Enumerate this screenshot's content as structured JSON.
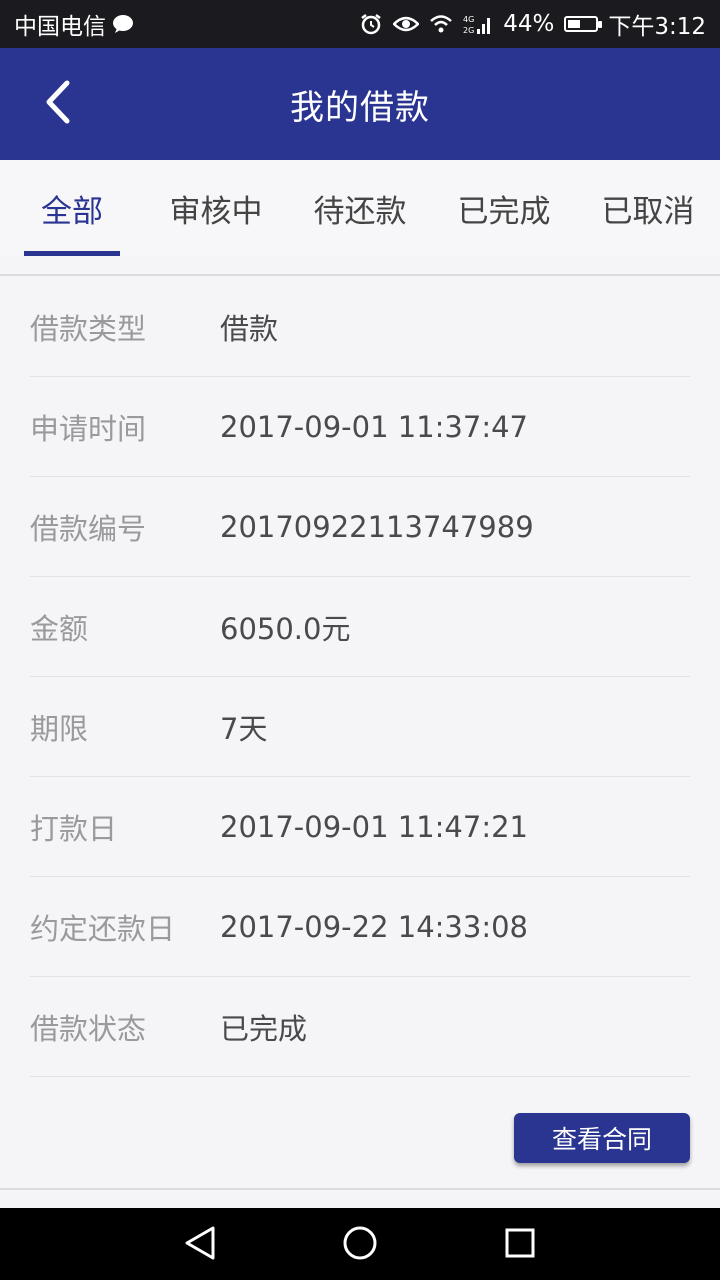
{
  "status_bar": {
    "carrier": "中国电信",
    "battery": "44%",
    "time": "下午3:12",
    "battery_level": 0.44,
    "icons": [
      "chat-bubble-icon",
      "alarm-icon",
      "eye-icon",
      "wifi-icon",
      "signal-icon",
      "battery-icon"
    ]
  },
  "header": {
    "title": "我的借款",
    "back_icon": "chevron-left-icon",
    "color": "#2a3491"
  },
  "tabs": [
    {
      "label": "全部",
      "active": true
    },
    {
      "label": "审核中",
      "active": false
    },
    {
      "label": "待还款",
      "active": false
    },
    {
      "label": "已完成",
      "active": false
    },
    {
      "label": "已取消",
      "active": false
    }
  ],
  "details": [
    {
      "label": "借款类型",
      "value": "借款"
    },
    {
      "label": "申请时间",
      "value": "2017-09-01 11:37:47"
    },
    {
      "label": "借款编号",
      "value": "20170922113747989"
    },
    {
      "label": "金额",
      "value": "6050.0元"
    },
    {
      "label": "期限",
      "value": "7天"
    },
    {
      "label": "打款日",
      "value": "2017-09-01 11:47:21"
    },
    {
      "label": "约定还款日",
      "value": "2017-09-22 14:33:08"
    },
    {
      "label": "借款状态",
      "value": "已完成"
    }
  ],
  "actions": {
    "view_contract": "查看合同"
  },
  "nav": {
    "icons": [
      "back-triangle-icon",
      "home-circle-icon",
      "recents-square-icon"
    ]
  }
}
